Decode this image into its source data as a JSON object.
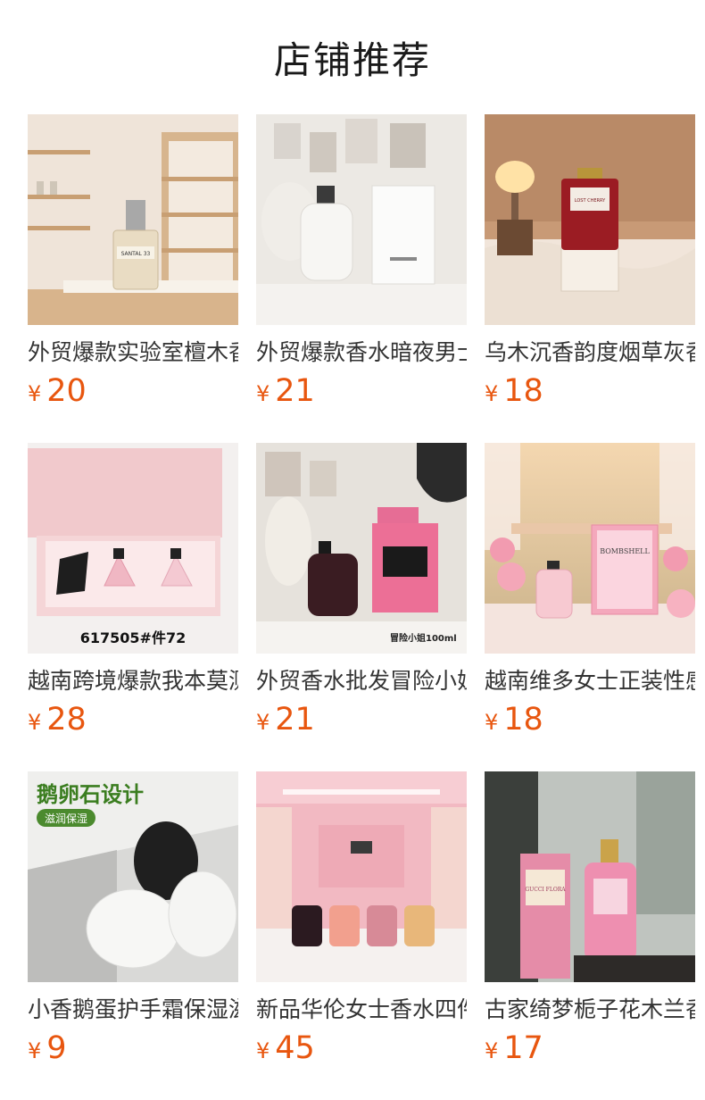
{
  "page": {
    "title": "店铺推荐"
  },
  "currency_symbol": "¥",
  "products": [
    {
      "name": "外贸爆款实验室檀木香水",
      "price": "20",
      "image_text": "SANTAL 33"
    },
    {
      "name": "外贸爆款香水暗夜男士",
      "price": "21",
      "image_text": ""
    },
    {
      "name": "乌木沉香韵度烟草灰香水",
      "price": "18",
      "image_text": "LOST CHERRY"
    },
    {
      "name": "越南跨境爆款我本莫测",
      "price": "28",
      "image_text": "617505#件72"
    },
    {
      "name": "外贸香水批发冒险小姐",
      "price": "21",
      "image_text": "冒险小姐100ml"
    },
    {
      "name": "越南维多女士正装性感",
      "price": "18",
      "image_text": "BOMBSHELL"
    },
    {
      "name": "小香鹅蛋护手霜保湿滋润",
      "price": "9",
      "image_text": "鹅卵石设计",
      "image_badge": "滋润保湿"
    },
    {
      "name": "新品华伦女士香水四件套",
      "price": "45",
      "image_text": ""
    },
    {
      "name": "古家绮梦栀子花木兰香水",
      "price": "17",
      "image_text": "GUCCI FLORA"
    }
  ]
}
